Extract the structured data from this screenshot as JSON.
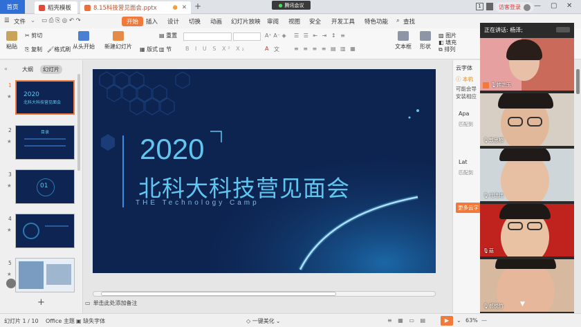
{
  "tabs": {
    "home": "首页",
    "template": "稻壳模板",
    "document": "8.15科技营见面会.pptx",
    "meeting": "腾讯会议",
    "login": "访客登录"
  },
  "menu": {
    "file": "文件",
    "items": [
      "开始",
      "插入",
      "设计",
      "切换",
      "动画",
      "幻灯片放映",
      "审阅",
      "视图",
      "安全",
      "开发工具",
      "特色功能"
    ],
    "search": "查找"
  },
  "ribbon": {
    "paste": "粘贴",
    "cut": "剪切",
    "copy": "复制",
    "format_painter": "格式刷",
    "play_from_start": "从头开始",
    "new_slide": "新建幻灯片",
    "layout": "版式",
    "section": "节",
    "reset": "重置",
    "textbox": "文本框",
    "shape": "形状",
    "arrange": "排列",
    "picture": "图片",
    "fill": "填充"
  },
  "left_panel": {
    "tab_outline": "大纲",
    "tab_slides": "幻灯片",
    "slide_numbers": [
      "1",
      "2",
      "3",
      "4",
      "5"
    ],
    "add": "+"
  },
  "slide": {
    "year": "2020",
    "title": "北科大科技营见面会",
    "subtitle": "THE Technology Camp"
  },
  "thumbs": {
    "t1_year": "2020",
    "t1_title": "北科大科技营见面会",
    "t2_title": "目录",
    "t3_num": "01"
  },
  "notes_placeholder": "单击此处添加备注",
  "right_panel": {
    "cloud_font": "云字体",
    "local_prefix": "本机",
    "text1": "可能会导",
    "text2": "安装相应",
    "item1": "Apa",
    "item1_sub": "匹配到",
    "item2": "Lat",
    "item2_sub": "匹配到",
    "more": "更多云字"
  },
  "video": {
    "speaking_label": "正在讲话: 杨泽;",
    "participants": [
      "韩芷玉",
      "敦思楠",
      "代玮炜",
      "菇",
      "郝悦竹"
    ]
  },
  "status": {
    "slide_pos": "幻灯片 1 / 10",
    "theme": "Office 主题",
    "missing_font": "缺失字体",
    "beautify": "一键美化",
    "zoom": "63%"
  },
  "colors": {
    "accent": "#f17a3a",
    "slide_bg": "#0d2350",
    "slide_text": "#5fc6f0"
  }
}
